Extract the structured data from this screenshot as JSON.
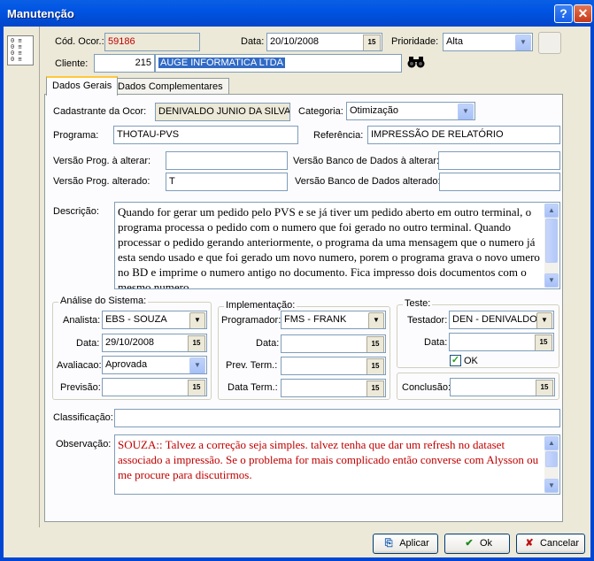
{
  "window": {
    "title": "Manutenção",
    "help_glyph": "?",
    "close_glyph": "✕"
  },
  "header": {
    "cod_ocor_label": "Cód. Ocor.:",
    "cod_ocor_value": "59186",
    "data_label": "Data:",
    "data_value": "20/10/2008",
    "prioridade_label": "Prioridade:",
    "prioridade_value": "Alta",
    "cliente_label": "Cliente:",
    "cliente_code": "215",
    "cliente_name": "AUGE INFORMATICA LTDA"
  },
  "tabs": [
    "Dados Gerais",
    "Dados Complementares"
  ],
  "general": {
    "cadastrante_label": "Cadastrante da Ocor:",
    "cadastrante_value": "DENIVALDO JUNIO DA SILVA (I",
    "categoria_label": "Categoria:",
    "categoria_value": "Otimização",
    "programa_label": "Programa:",
    "programa_value": "THOTAU-PVS",
    "referencia_label": "Referência:",
    "referencia_value": "IMPRESSÃO DE RELATÓRIO",
    "versao_alterar_label": "Versão Prog. à alterar:",
    "versao_alterar_value": "",
    "versao_bd_alterar_label": "Versão Banco de Dados à alterar:",
    "versao_bd_alterar_value": "",
    "versao_alterado_label": "Versão Prog. alterado:",
    "versao_alterado_value": "T",
    "versao_bd_alterado_label": "Versão Banco de Dados alterado:",
    "versao_bd_alterado_value": "",
    "descricao_label": "Descrição:",
    "descricao_value": "Quando for gerar um pedido pelo PVS e se já tiver um pedido aberto em outro terminal, o programa processa o pedido com o numero que foi gerado no outro terminal. Quando processar o pedido gerando anteriormente, o programa da uma mensagem que o numero já esta sendo usado e que foi gerado um novo numero, porem o programa grava o novo umero no BD e imprime o numero antigo no documento. Fica impresso dois documentos com o mesmo numero.",
    "analise": {
      "title": "Análise do Sistema:",
      "analista_label": "Analista:",
      "analista_value": "EBS - SOUZA",
      "data_label": "Data:",
      "data_value": "29/10/2008",
      "avaliacao_label": "Avaliacao:",
      "avaliacao_value": "Aprovada",
      "previsao_label": "Previsão:",
      "previsao_value": ""
    },
    "implementacao": {
      "title": "Implementação:",
      "programador_label": "Programador:",
      "programador_value": "FMS - FRANK",
      "data_label": "Data:",
      "data_value": "",
      "prev_term_label": "Prev. Term.:",
      "prev_term_value": "",
      "data_term_label": "Data Term.:",
      "data_term_value": ""
    },
    "teste": {
      "title": "Teste:",
      "testador_label": "Testador:",
      "testador_value": "DEN - DENIVALDO",
      "data_label": "Data:",
      "data_value": "",
      "ok_label": "OK",
      "ok_checked": true
    },
    "conclusao_label": "Conclusão:",
    "conclusao_value": "",
    "classificacao_label": "Classificação:",
    "classificacao_value": "",
    "observacao_label": "Observação:",
    "observacao_value": "SOUZA:: Talvez a correção seja simples. talvez tenha que dar um refresh no dataset associado a impressão. Se o problema for mais complicado então converse com Alysson ou me procure para discutirmos."
  },
  "buttons": {
    "aplicar": "Aplicar",
    "ok": "Ok",
    "cancelar": "Cancelar"
  },
  "icons": {
    "calendar": "15",
    "dropdown": "▼",
    "binoculars": "🔭",
    "scroll_up": "▲",
    "scroll_down": "▼"
  },
  "colors": {
    "titlebar": "#0054E3",
    "highlight": "#316AC5",
    "red_text": "#C00000"
  }
}
